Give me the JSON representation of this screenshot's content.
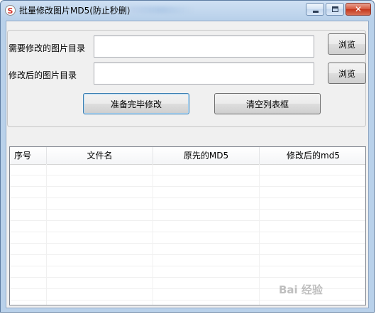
{
  "window": {
    "title": "批量修改图片MD5(防止秒删)",
    "icon_letter": "S",
    "minimize_icon": "minimize-icon",
    "maximize_icon": "maximize-icon",
    "close_icon": "close-icon",
    "close_glyph": "✕"
  },
  "form": {
    "source_dir_label": "需要修改的图片目录",
    "source_dir_value": "",
    "output_dir_label": "修改后的图片目录",
    "output_dir_value": "",
    "browse_label_1": "浏览",
    "browse_label_2": "浏览",
    "start_button": "准备完毕修改",
    "clear_button": "清空列表框"
  },
  "table": {
    "columns": [
      "序号",
      "文件名",
      "原先的MD5",
      "修改后的md5"
    ],
    "rows": []
  },
  "watermark": "Bai 经验",
  "colors": {
    "window_frame": "#b9d1ea",
    "client_bg": "#f0f0f0",
    "close_red": "#c4371d"
  }
}
